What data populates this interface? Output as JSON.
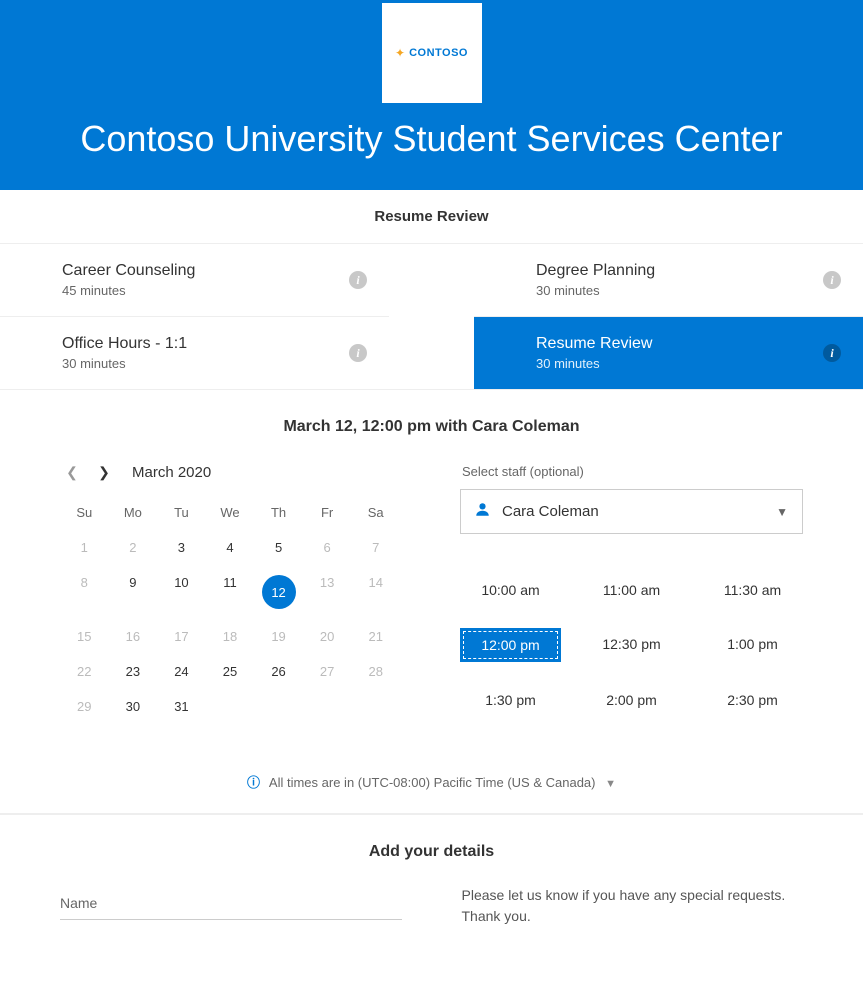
{
  "brand": {
    "name": "CONTOSO"
  },
  "hero": {
    "title": "Contoso University Student Services Center"
  },
  "section_service_title": "Resume Review",
  "services": [
    {
      "name": "Career Counseling",
      "duration": "45 minutes",
      "selected": false
    },
    {
      "name": "Degree Planning",
      "duration": "30 minutes",
      "selected": false
    },
    {
      "name": "Office Hours - 1:1",
      "duration": "30 minutes",
      "selected": false
    },
    {
      "name": "Resume Review",
      "duration": "30 minutes",
      "selected": true
    }
  ],
  "summary": "March 12, 12:00 pm with Cara Coleman",
  "calendar": {
    "month_label": "March 2020",
    "dow": [
      "Su",
      "Mo",
      "Tu",
      "We",
      "Th",
      "Fr",
      "Sa"
    ],
    "weeks": [
      [
        {
          "n": "1",
          "dis": true
        },
        {
          "n": "2",
          "dis": true
        },
        {
          "n": "3"
        },
        {
          "n": "4"
        },
        {
          "n": "5"
        },
        {
          "n": "6",
          "dis": true
        },
        {
          "n": "7",
          "dis": true
        }
      ],
      [
        {
          "n": "8",
          "dis": true
        },
        {
          "n": "9"
        },
        {
          "n": "10"
        },
        {
          "n": "11"
        },
        {
          "n": "12",
          "sel": true
        },
        {
          "n": "13",
          "dis": true
        },
        {
          "n": "14",
          "dis": true
        }
      ],
      [
        {
          "n": "15",
          "dis": true
        },
        {
          "n": "16",
          "dis": true
        },
        {
          "n": "17",
          "dis": true
        },
        {
          "n": "18",
          "dis": true
        },
        {
          "n": "19",
          "dis": true
        },
        {
          "n": "20",
          "dis": true
        },
        {
          "n": "21",
          "dis": true
        }
      ],
      [
        {
          "n": "22",
          "dis": true
        },
        {
          "n": "23"
        },
        {
          "n": "24"
        },
        {
          "n": "25"
        },
        {
          "n": "26"
        },
        {
          "n": "27",
          "dis": true
        },
        {
          "n": "28",
          "dis": true
        }
      ],
      [
        {
          "n": "29",
          "dis": true
        },
        {
          "n": "30"
        },
        {
          "n": "31"
        },
        {
          "n": ""
        },
        {
          "n": ""
        },
        {
          "n": ""
        },
        {
          "n": ""
        }
      ]
    ]
  },
  "staff": {
    "label": "Select staff (optional)",
    "selected": "Cara Coleman"
  },
  "times": [
    {
      "t": "10:00 am"
    },
    {
      "t": "11:00 am"
    },
    {
      "t": "11:30 am"
    },
    {
      "t": "12:00 pm",
      "sel": true
    },
    {
      "t": "12:30 pm"
    },
    {
      "t": "1:00 pm"
    },
    {
      "t": "1:30 pm"
    },
    {
      "t": "2:00 pm"
    },
    {
      "t": "2:30 pm"
    }
  ],
  "timezone": {
    "prefix": "All times are in",
    "value": "(UTC-08:00) Pacific Time (US & Canada)"
  },
  "details": {
    "title": "Add your details",
    "name_placeholder": "Name",
    "request_text": "Please let us know if you have any special requests. Thank you."
  }
}
